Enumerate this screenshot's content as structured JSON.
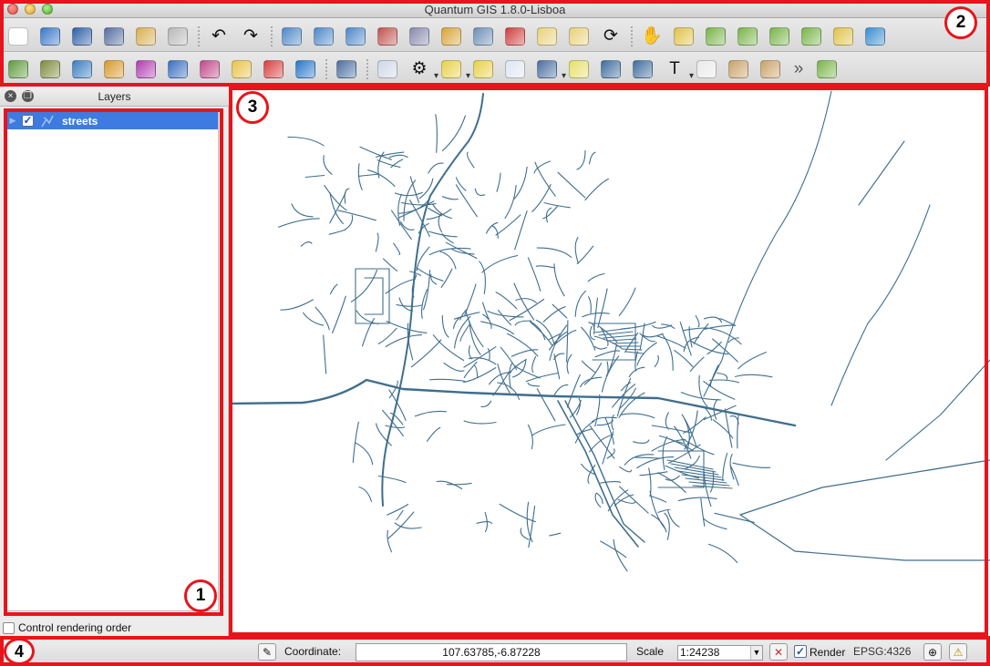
{
  "window": {
    "title": "Quantum GIS 1.8.0-Lisboa"
  },
  "toolbar_main": {
    "buttons": [
      {
        "icon": "new-project-icon",
        "glyph": "",
        "color": "#ffffff"
      },
      {
        "icon": "open-project-icon",
        "glyph": "",
        "color": "#3b78c8"
      },
      {
        "icon": "save-project-icon",
        "glyph": "",
        "color": "#2f5fa8"
      },
      {
        "icon": "save-as-icon",
        "glyph": "",
        "color": "#556fa0"
      },
      {
        "icon": "new-print-composer-icon",
        "glyph": "",
        "color": "#d8b050"
      },
      {
        "icon": "print-icon",
        "glyph": "",
        "color": "#b9b9b9"
      },
      {
        "icon": "undo-icon",
        "glyph": "↶",
        "color": ""
      },
      {
        "icon": "redo-icon",
        "glyph": "↷",
        "color": ""
      },
      {
        "icon": "add-feature-icon",
        "glyph": "",
        "color": "#4f89c9"
      },
      {
        "icon": "add-ring-icon",
        "glyph": "",
        "color": "#4f89c9"
      },
      {
        "icon": "add-part-icon",
        "glyph": "",
        "color": "#4f89c9"
      },
      {
        "icon": "delete-ring-icon",
        "glyph": "",
        "color": "#c2544f"
      },
      {
        "icon": "delete-part-icon",
        "glyph": "",
        "color": "#8a8ab0"
      },
      {
        "icon": "node-tool-icon",
        "glyph": "",
        "color": "#d9a53a"
      },
      {
        "icon": "split-features-icon",
        "glyph": "",
        "color": "#6f8fb8"
      },
      {
        "icon": "reshape-icon",
        "glyph": "",
        "color": "#cf3f3f"
      },
      {
        "icon": "merge-features-icon",
        "glyph": "",
        "color": "#e8d27a"
      },
      {
        "icon": "merge-attributes-icon",
        "glyph": "",
        "color": "#e8d27a"
      },
      {
        "icon": "rotate-point-symbols-icon",
        "glyph": "⟳",
        "color": ""
      },
      {
        "icon": "pan-icon",
        "glyph": "✋",
        "color": ""
      },
      {
        "icon": "pan-to-selection-icon",
        "glyph": "",
        "color": "#e0c34a"
      },
      {
        "icon": "zoom-in-icon",
        "glyph": "",
        "color": "#7ab54a"
      },
      {
        "icon": "zoom-out-icon",
        "glyph": "",
        "color": "#7ab54a"
      },
      {
        "icon": "zoom-full-icon",
        "glyph": "",
        "color": "#7ab54a"
      },
      {
        "icon": "zoom-to-selection-icon",
        "glyph": "",
        "color": "#7ab54a"
      },
      {
        "icon": "zoom-to-layer-icon",
        "glyph": "",
        "color": "#e0c34a"
      },
      {
        "icon": "zoom-last-icon",
        "glyph": "",
        "color": "#3a8fd1"
      }
    ]
  },
  "toolbar_layers": {
    "buttons": [
      {
        "icon": "add-vector-layer-icon",
        "glyph": "",
        "color": "#5f9b3d"
      },
      {
        "icon": "add-raster-layer-icon",
        "glyph": "",
        "color": "#7f8b3d"
      },
      {
        "icon": "add-postgis-layer-icon",
        "glyph": "",
        "color": "#3a7fc1"
      },
      {
        "icon": "add-spatialite-layer-icon",
        "glyph": "",
        "color": "#d79b2c"
      },
      {
        "icon": "add-mssql-layer-icon",
        "glyph": "",
        "color": "#b03fb0"
      },
      {
        "icon": "add-wms-layer-icon",
        "glyph": "",
        "color": "#3a6fc1"
      },
      {
        "icon": "add-wcs-layer-icon",
        "glyph": "",
        "color": "#c04a8a"
      },
      {
        "icon": "new-shapefile-icon",
        "glyph": "",
        "color": "#e8c44a"
      },
      {
        "icon": "remove-layer-icon",
        "glyph": "",
        "color": "#d84040"
      },
      {
        "icon": "add-delimited-text-icon",
        "glyph": "",
        "color": "#2a78c9"
      },
      {
        "icon": "database-icon",
        "glyph": "",
        "color": "#4b6fa0"
      },
      {
        "icon": "identify-features-icon",
        "glyph": "",
        "color": "#cfd8e8"
      },
      {
        "icon": "run-action-icon",
        "glyph": "⚙",
        "color": ""
      },
      {
        "icon": "select-features-icon",
        "glyph": "",
        "color": "#e8d14a"
      },
      {
        "icon": "deselect-icon",
        "glyph": "",
        "color": "#e8d14a"
      },
      {
        "icon": "attribute-table-icon",
        "glyph": "",
        "color": "#dfe6f1"
      },
      {
        "icon": "measure-line-icon",
        "glyph": "",
        "color": "#4b6fa0"
      },
      {
        "icon": "map-tips-icon",
        "glyph": "",
        "color": "#e6e06a"
      },
      {
        "icon": "new-bookmark-icon",
        "glyph": "",
        "color": "#3f6e9e"
      },
      {
        "icon": "show-bookmarks-icon",
        "glyph": "",
        "color": "#3f6e9e"
      },
      {
        "icon": "text-annotation-icon",
        "glyph": "T",
        "color": ""
      },
      {
        "icon": "label-icon",
        "glyph": "",
        "color": "#eaeaea"
      },
      {
        "icon": "move-label-icon",
        "glyph": "",
        "color": "#c9a36a"
      },
      {
        "icon": "rotate-label-icon",
        "glyph": "",
        "color": "#c9a36a"
      },
      {
        "icon": "more-icon",
        "glyph": "»",
        "color": ""
      },
      {
        "icon": "plugin-icon",
        "glyph": "",
        "color": "#7ab54a"
      }
    ]
  },
  "layers_panel": {
    "title": "Layers",
    "items": [
      {
        "name": "streets",
        "checked": true
      }
    ],
    "control_rendering_order": "Control rendering order"
  },
  "statusbar": {
    "coordinate_label": "Coordinate:",
    "coordinate_value": "107.63785,-6.87228",
    "scale_label": "Scale",
    "scale_value": "1:24238",
    "render_label": "Render",
    "render_checked": true,
    "crs": "EPSG:4326"
  },
  "map": {
    "line_color": "#3f6e8e"
  },
  "annotations": [
    {
      "number": "1"
    },
    {
      "number": "2"
    },
    {
      "number": "3"
    },
    {
      "number": "4"
    }
  ]
}
